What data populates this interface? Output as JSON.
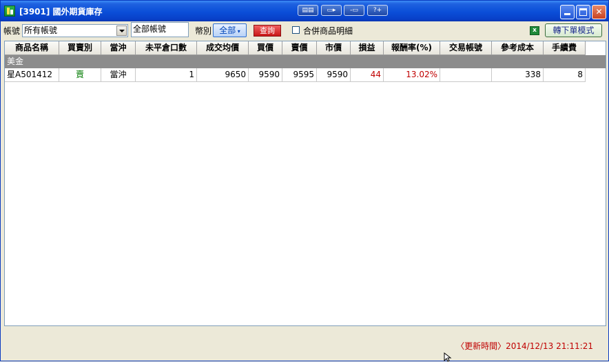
{
  "window": {
    "title": "[3901] 國外期貨庫存",
    "toolbar_buttons": [
      "tile-windows-icon",
      "window-arrange-icon",
      "window-dock-icon",
      "help-icon"
    ],
    "help_label": "?+"
  },
  "filters": {
    "account_label": "帳號",
    "account_selected": "所有帳號",
    "account_text": "全部帳號",
    "currency_label": "幣別",
    "currency_selected": "全部",
    "query_label": "查詢",
    "merge_label": "合併商品明細",
    "mode_button": "轉下單模式"
  },
  "table": {
    "columns": [
      "商品名稱",
      "買賣別",
      "當沖",
      "未平倉口數",
      "成交均價",
      "買價",
      "賣價",
      "市價",
      "損益",
      "報酬率(%)",
      "交易帳號",
      "參考成本",
      "手續費"
    ],
    "group": "美金",
    "rows": [
      {
        "product": "星A501412",
        "side": "賣",
        "daytrade": "當沖",
        "open_qty": "1",
        "avg_price": "9650",
        "bid": "9590",
        "ask": "9595",
        "market": "9590",
        "pnl": "44",
        "return_rate": "13.02%",
        "account": "",
        "ref_cost": "338",
        "fee": "8"
      }
    ]
  },
  "status": {
    "update_time": "〈更新時間〉2014/12/13 21:11:21"
  },
  "colors": {
    "title_bar": "#0a4ed8",
    "group_row": "#8c8c8c",
    "profit_red": "#c00000",
    "side_green": "#007a00"
  }
}
